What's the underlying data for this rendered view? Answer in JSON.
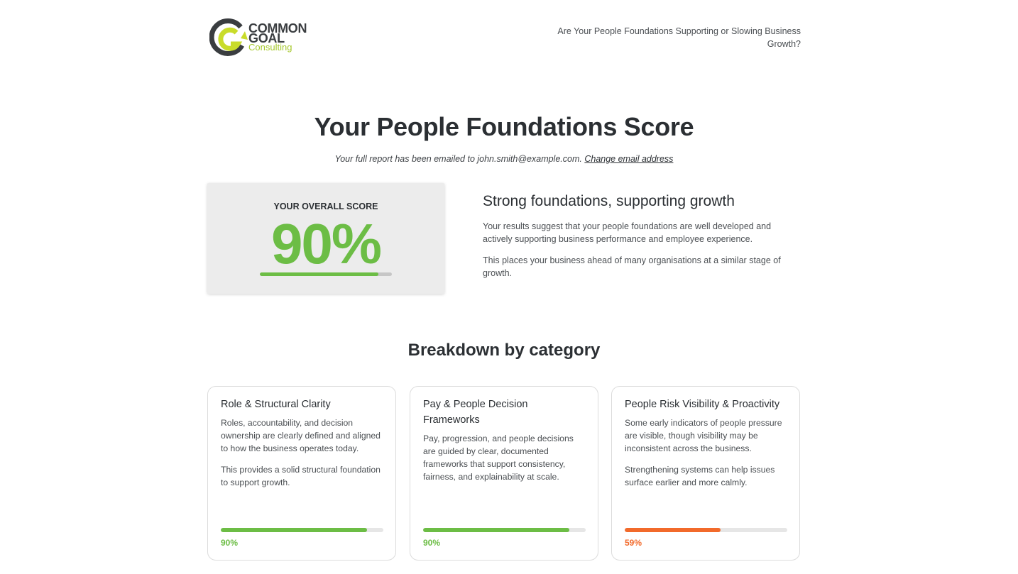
{
  "header": {
    "logo": {
      "line1": "COMMON",
      "line2": "GOAL",
      "line3": "Consulting"
    },
    "question": "Are Your People Foundations Supporting or Slowing Business Growth?"
  },
  "page_title": "Your People Foundations Score",
  "email_note": {
    "text": "Your full report has been emailed to john.smith@example.com.",
    "link": "Change email address"
  },
  "overall": {
    "label": "YOUR OVERALL SCORE",
    "score_text": "90%",
    "score": 90
  },
  "summary": {
    "heading": "Strong foundations, supporting growth",
    "paragraphs": [
      "Your results suggest that your people foundations are well developed and actively supporting business performance and employee experience.",
      "This places your business ahead of many organisations at a similar stage of growth."
    ]
  },
  "breakdown": {
    "title": "Breakdown by category",
    "cards": [
      {
        "title": "Role & Structural Clarity",
        "paragraphs": [
          "Roles, accountability, and decision ownership are clearly defined and aligned to how the business operates today.",
          "This provides a solid structural foundation to support growth."
        ],
        "score_text": "90%",
        "score": 90,
        "color": "#6cbd45"
      },
      {
        "title": "Pay & People Decision Frameworks",
        "paragraphs": [
          "Pay, progression, and people decisions are guided by clear, documented frameworks that support consistency, fairness, and explainability at scale."
        ],
        "score_text": "90%",
        "score": 90,
        "color": "#6cbd45"
      },
      {
        "title": "People Risk Visibility & Proactivity",
        "paragraphs": [
          "Some early indicators of people pressure are visible, though visibility may be inconsistent across the business.",
          "Strengthening systems can help issues surface earlier and more calmly."
        ],
        "score_text": "59%",
        "score": 59,
        "color": "#f26a2b"
      }
    ]
  },
  "colors": {
    "green": "#6cbd45",
    "orange": "#f26a2b",
    "lime": "#a6c82d"
  }
}
